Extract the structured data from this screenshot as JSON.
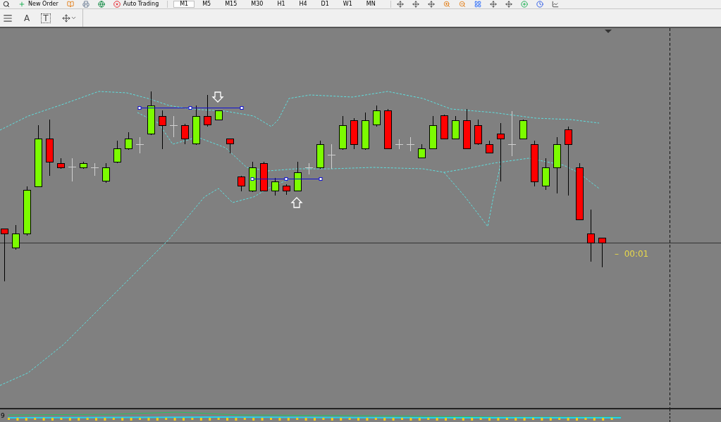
{
  "toolbar": {
    "new_order": "New Order",
    "auto_trading": "Auto Trading",
    "timeframes": [
      {
        "label": "M1",
        "selected": true
      },
      {
        "label": "M5",
        "selected": false
      },
      {
        "label": "M15",
        "selected": false
      },
      {
        "label": "M30",
        "selected": false
      },
      {
        "label": "H1",
        "selected": false
      },
      {
        "label": "H4",
        "selected": false
      },
      {
        "label": "D1",
        "selected": false
      },
      {
        "label": "W1",
        "selected": false
      },
      {
        "label": "MN",
        "selected": false
      }
    ]
  },
  "drawing_toolbar": {
    "text_tool": "A",
    "label_tool": "T"
  },
  "chart": {
    "countdown": "–  00:01"
  },
  "indicator_window": {
    "value": "9"
  }
}
